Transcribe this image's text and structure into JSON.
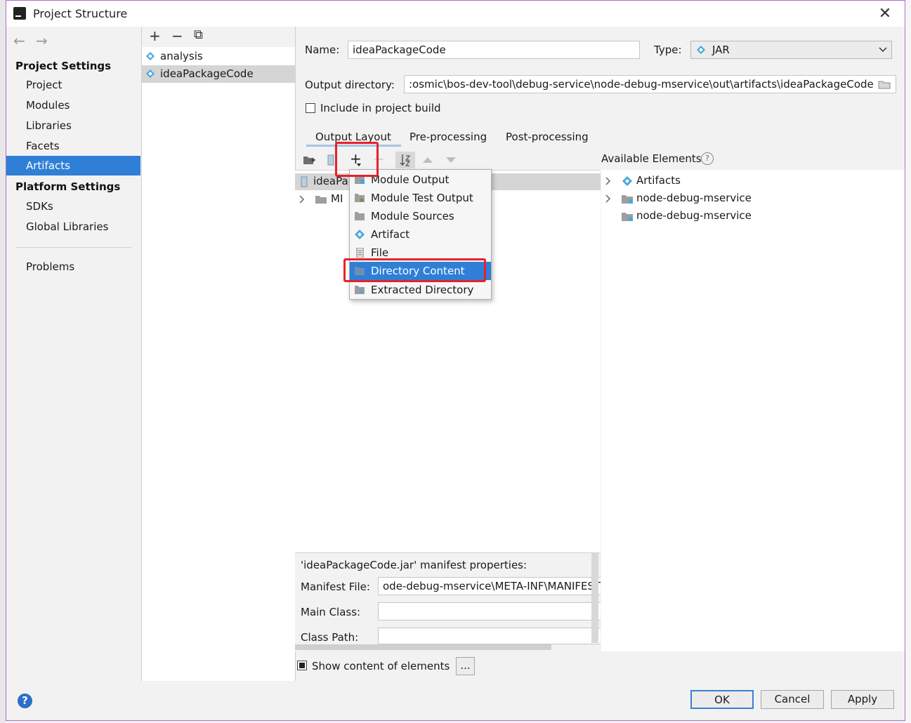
{
  "window": {
    "title": "Project Structure",
    "close": "✕"
  },
  "nav": {
    "back": "←",
    "forward": "→",
    "project_settings": "Project Settings",
    "ps_items": [
      "Project",
      "Modules",
      "Libraries",
      "Facets",
      "Artifacts"
    ],
    "platform_settings": "Platform Settings",
    "pl_items": [
      "SDKs",
      "Global Libraries"
    ],
    "problems": "Problems"
  },
  "list": {
    "toolbar": {
      "add": "+",
      "remove": "−",
      "copy": "⧉"
    },
    "items": [
      "analysis",
      "ideaPackageCode"
    ]
  },
  "form": {
    "name_label": "Name:",
    "name_value": "ideaPackageCode",
    "type_label": "Type:",
    "type_value": "JAR",
    "output_label": "Output directory:",
    "output_value": ":osmic\\bos-dev-tool\\debug-service\\node-debug-mservice\\out\\artifacts\\ideaPackageCode",
    "include_build": "Include in project build"
  },
  "tabs": [
    "Output Layout",
    "Pre-processing",
    "Post-processing"
  ],
  "layout_toolbar": {
    "add": "+"
  },
  "tree": {
    "root": "ideaPa",
    "child": "MI"
  },
  "popup": {
    "items": [
      "Module Output",
      "Module Test Output",
      "Module Sources",
      "Artifact",
      "File",
      "Directory Content",
      "Extracted Directory"
    ]
  },
  "available": {
    "label": "Available Elements",
    "help": "?",
    "items": [
      "Artifacts",
      "node-debug-mservice",
      "node-debug-mservice"
    ]
  },
  "manifest": {
    "title": "'ideaPackageCode.jar' manifest properties:",
    "file_label": "Manifest File:",
    "file_value": "ode-debug-mservice\\META-INF\\MANIFEST",
    "main_class_label": "Main Class:",
    "main_class_value": "",
    "class_path_label": "Class Path:",
    "class_path_value": ""
  },
  "show_content": "Show content of elements",
  "ellipsis": "...",
  "buttons": {
    "ok": "OK",
    "cancel": "Cancel",
    "apply": "Apply",
    "help": "?"
  },
  "colors": {
    "selection": "#2f7fd6",
    "highlight": "#e8212a",
    "artifact_icon": "#4aa8d8"
  }
}
